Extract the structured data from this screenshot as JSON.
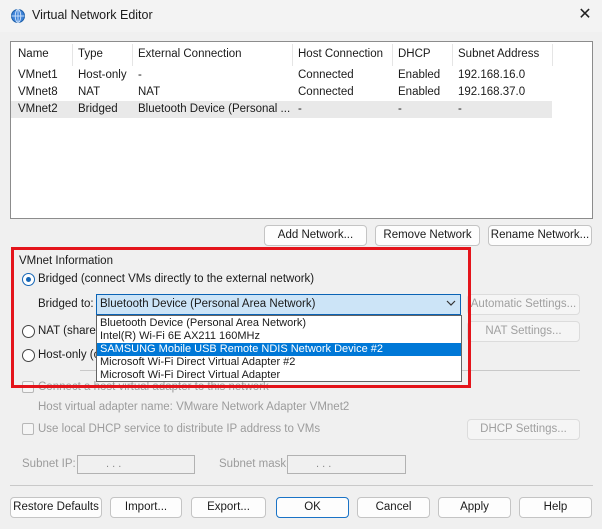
{
  "window": {
    "title": "Virtual Network Editor",
    "close_glyph": "✕"
  },
  "table": {
    "headers": [
      "Name",
      "Type",
      "External Connection",
      "Host Connection",
      "DHCP",
      "Subnet Address"
    ],
    "rows": [
      [
        "VMnet1",
        "Host-only",
        "-",
        "Connected",
        "Enabled",
        "192.168.16.0"
      ],
      [
        "VMnet8",
        "NAT",
        "NAT",
        "Connected",
        "Enabled",
        "192.168.37.0"
      ],
      [
        "VMnet2",
        "Bridged",
        "Bluetooth Device (Personal ...",
        "-",
        "-",
        "-"
      ]
    ],
    "selected_row": 2
  },
  "network_buttons": {
    "add": "Add Network...",
    "remove": "Remove Network",
    "rename": "Rename Network..."
  },
  "vmnet_info": {
    "group_label": "VMnet Information",
    "bridged_label": "Bridged (connect VMs directly to the external network)",
    "bridged_to_label": "Bridged to:",
    "bridged_to_value": "Bluetooth Device (Personal Area Network)",
    "automatic_settings": "Automatic Settings...",
    "nat_label": "NAT (shared",
    "nat_settings": "NAT Settings...",
    "hostonly_label": "Host-only (c",
    "connect_adapter_label": "Connect a host virtual adapter to this network",
    "adapter_name_label": "Host virtual adapter name: VMware Network Adapter VMnet2",
    "dhcp_label": "Use local DHCP service to distribute IP address to VMs",
    "dhcp_settings": "DHCP Settings...",
    "subnet_ip_label": "Subnet IP:",
    "subnet_mask_label": "Subnet mask:",
    "ip_dots": ".       .       ."
  },
  "dropdown_options": [
    "Bluetooth Device (Personal Area Network)",
    "Intel(R) Wi-Fi 6E AX211 160MHz",
    "SAMSUNG Mobile USB Remote NDIS Network Device #2",
    "Microsoft Wi-Fi Direct Virtual Adapter #2",
    "Microsoft Wi-Fi Direct Virtual Adapter"
  ],
  "dropdown_highlighted": 2,
  "footer_buttons": {
    "restore": "Restore Defaults",
    "import": "Import...",
    "export": "Export...",
    "ok": "OK",
    "cancel": "Cancel",
    "apply": "Apply",
    "help": "Help"
  },
  "colors": {
    "accent": "#0078d7",
    "annotation": "#e4141b",
    "selected_row": "#e9e9e9"
  }
}
